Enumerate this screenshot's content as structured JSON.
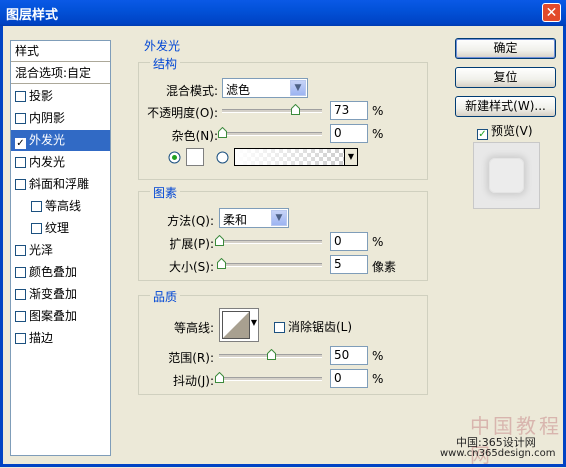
{
  "window": {
    "title": "图层样式",
    "close_glyph": "✕"
  },
  "left_list": {
    "header": "样式",
    "blend_options": "混合选项:自定",
    "items": [
      {
        "label": "投影",
        "checked": false
      },
      {
        "label": "内阴影",
        "checked": false
      },
      {
        "label": "外发光",
        "checked": true,
        "selected": true
      },
      {
        "label": "内发光",
        "checked": false
      },
      {
        "label": "斜面和浮雕",
        "checked": false
      },
      {
        "label": "等高线",
        "checked": false,
        "indent": true
      },
      {
        "label": "纹理",
        "checked": false,
        "indent": true
      },
      {
        "label": "光泽",
        "checked": false
      },
      {
        "label": "颜色叠加",
        "checked": false
      },
      {
        "label": "渐变叠加",
        "checked": false
      },
      {
        "label": "图案叠加",
        "checked": false
      },
      {
        "label": "描边",
        "checked": false
      }
    ]
  },
  "outer_glow": {
    "title": "外发光",
    "structure": {
      "title": "结构",
      "blend_mode_label": "混合模式:",
      "blend_mode_value": "滤色",
      "opacity_label": "不透明度(O):",
      "opacity_value": "73",
      "opacity_unit": "%",
      "opacity_fraction": 0.73,
      "noise_label": "杂色(N):",
      "noise_value": "0",
      "noise_unit": "%",
      "noise_fraction": 0.0,
      "color_swatch": "#ffffff",
      "solid_radio_selected": true
    },
    "elements": {
      "title": "图素",
      "method_label": "方法(Q):",
      "method_value": "柔和",
      "spread_label": "扩展(P):",
      "spread_value": "0",
      "spread_unit": "%",
      "spread_fraction": 0.0,
      "size_label": "大小(S):",
      "size_value": "5",
      "size_unit": "像素",
      "size_fraction": 0.02
    },
    "quality": {
      "title": "品质",
      "contour_label": "等高线:",
      "antialias_label": "消除锯齿(L)",
      "antialias_checked": false,
      "range_label": "范围(R):",
      "range_value": "50",
      "range_unit": "%",
      "range_fraction": 0.5,
      "jitter_label": "抖动(J):",
      "jitter_value": "0",
      "jitter_unit": "%",
      "jitter_fraction": 0.0
    }
  },
  "buttons": {
    "ok": "确定",
    "reset": "复位",
    "new_style": "新建样式(W)...",
    "preview_label": "预览(V)",
    "preview_checked": true
  },
  "watermark": {
    "logo_text": "中国教程网",
    "line1": "中国:365设计网",
    "line2": "www.cn365design.com"
  },
  "colors": {
    "titlebar": "#0251d8",
    "selection": "#316ac5",
    "group_label": "#0046d5",
    "accent_green": "#3c8a3c"
  }
}
